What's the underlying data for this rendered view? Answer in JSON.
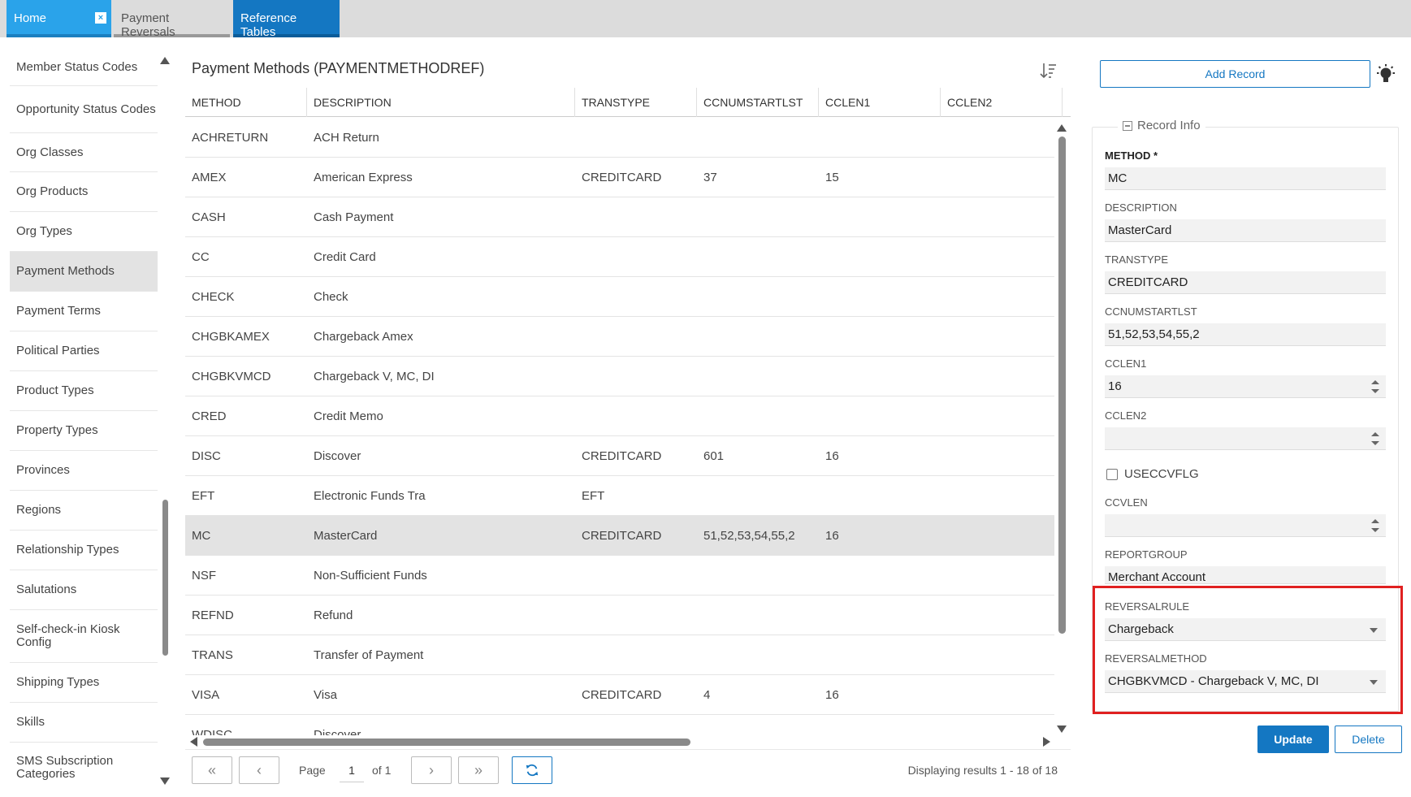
{
  "tabs": [
    {
      "label": "Home",
      "closable": true
    },
    {
      "label": "Payment Reversals"
    },
    {
      "label": "Reference Tables"
    }
  ],
  "nav": {
    "items": [
      "Member Status Codes",
      "Opportunity Status Codes",
      "Org Classes",
      "Org Products",
      "Org Types",
      "Payment Methods",
      "Payment Terms",
      "Political Parties",
      "Product Types",
      "Property Types",
      "Provinces",
      "Regions",
      "Relationship Types",
      "Salutations",
      "Self-check-in Kiosk Config",
      "Shipping Types",
      "Skills",
      "SMS Subscription Categories"
    ],
    "active": "Payment Methods"
  },
  "grid": {
    "title": "Payment Methods (PAYMENTMETHODREF)",
    "columns": [
      "METHOD",
      "DESCRIPTION",
      "TRANSTYPE",
      "CCNUMSTARTLST",
      "CCLEN1",
      "CCLEN2"
    ],
    "rows": [
      [
        "ACHRETURN",
        "ACH Return",
        "",
        "",
        "",
        ""
      ],
      [
        "AMEX",
        "American Express",
        "CREDITCARD",
        "37",
        "15",
        ""
      ],
      [
        "CASH",
        "Cash Payment",
        "",
        "",
        "",
        ""
      ],
      [
        "CC",
        "Credit Card",
        "",
        "",
        "",
        ""
      ],
      [
        "CHECK",
        "Check",
        "",
        "",
        "",
        ""
      ],
      [
        "CHGBKAMEX",
        "Chargeback Amex",
        "",
        "",
        "",
        ""
      ],
      [
        "CHGBKVMCD",
        "Chargeback V, MC, DI",
        "",
        "",
        "",
        ""
      ],
      [
        "CRED",
        "Credit Memo",
        "",
        "",
        "",
        ""
      ],
      [
        "DISC",
        "Discover",
        "CREDITCARD",
        "601",
        "16",
        ""
      ],
      [
        "EFT",
        "Electronic Funds Tra",
        "EFT",
        "",
        "",
        ""
      ],
      [
        "MC",
        "MasterCard",
        "CREDITCARD",
        "51,52,53,54,55,2",
        "16",
        ""
      ],
      [
        "NSF",
        "Non-Sufficient Funds",
        "",
        "",
        "",
        ""
      ],
      [
        "REFND",
        "Refund",
        "",
        "",
        "",
        ""
      ],
      [
        "TRANS",
        "Transfer of Payment",
        "",
        "",
        "",
        ""
      ],
      [
        "VISA",
        "Visa",
        "CREDITCARD",
        "4",
        "16",
        ""
      ],
      [
        "WDISC",
        "Discover",
        "",
        "",
        "",
        ""
      ]
    ],
    "selected_index": 10
  },
  "pager": {
    "page_label": "Page",
    "page": "1",
    "of_label": "of 1",
    "summary": "Displaying results 1 - 18 of 18"
  },
  "record": {
    "add_label": "Add Record",
    "legend": "Record Info",
    "fields": [
      {
        "label": "METHOD *",
        "value": "MC"
      },
      {
        "label": "DESCRIPTION",
        "value": "MasterCard"
      },
      {
        "label": "TRANSTYPE",
        "value": "CREDITCARD"
      },
      {
        "label": "CCNUMSTARTLST",
        "value": "51,52,53,54,55,2"
      },
      {
        "label": "CCLEN1",
        "value": "16"
      },
      {
        "label": "CCLEN2",
        "value": ""
      },
      {
        "label": "USECCVFLG",
        "checked": false
      },
      {
        "label": "CCVLEN",
        "value": ""
      },
      {
        "label": "REPORTGROUP",
        "value": "Merchant Account"
      },
      {
        "label": "REVERSALRULE",
        "value": "Chargeback"
      },
      {
        "label": "REVERSALMETHOD",
        "value": "CHGBKVMCD - Chargeback V, MC, DI"
      }
    ],
    "update_label": "Update",
    "delete_label": "Delete"
  },
  "colors": {
    "accent": "#1477c2",
    "home_tab": "#2aa3ea",
    "highlight": "#e02020",
    "selected_row": "#e3e3e3"
  }
}
